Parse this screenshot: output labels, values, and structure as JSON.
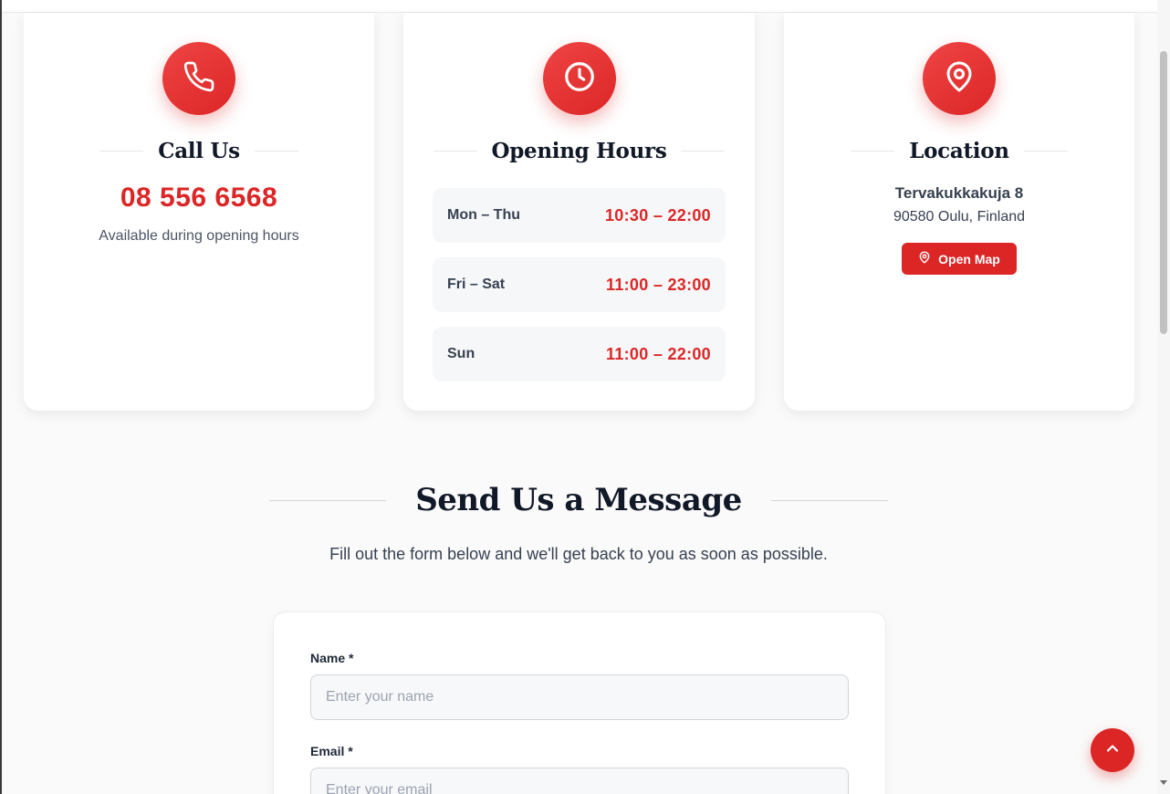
{
  "contact_cards": {
    "call": {
      "icon": "phone-icon",
      "title": "Call Us",
      "phone": "08 556 6568",
      "note": "Available during opening hours"
    },
    "hours": {
      "icon": "clock-icon",
      "title": "Opening Hours",
      "rows": [
        {
          "day": "Mon – Thu",
          "time": "10:30 – 22:00"
        },
        {
          "day": "Fri – Sat",
          "time": "11:00 – 23:00"
        },
        {
          "day": "Sun",
          "time": "11:00 – 22:00"
        }
      ]
    },
    "location": {
      "icon": "map-pin-icon",
      "title": "Location",
      "street": "Tervakukkakuja 8",
      "city": "90580 Oulu, Finland",
      "map_button": "Open Map"
    }
  },
  "message_section": {
    "title": "Send Us a Message",
    "subtitle": "Fill out the form below and we'll get back to you as soon as possible.",
    "form": {
      "name_label": "Name *",
      "name_placeholder": "Enter your name",
      "name_value": "",
      "email_label": "Email *",
      "email_placeholder": "Enter your email",
      "email_value": ""
    }
  },
  "back_to_top": {
    "icon": "chevron-up-icon"
  },
  "colors": {
    "accent": "#dc2626",
    "accent_light": "#ef4444",
    "text_dark": "#111827"
  }
}
